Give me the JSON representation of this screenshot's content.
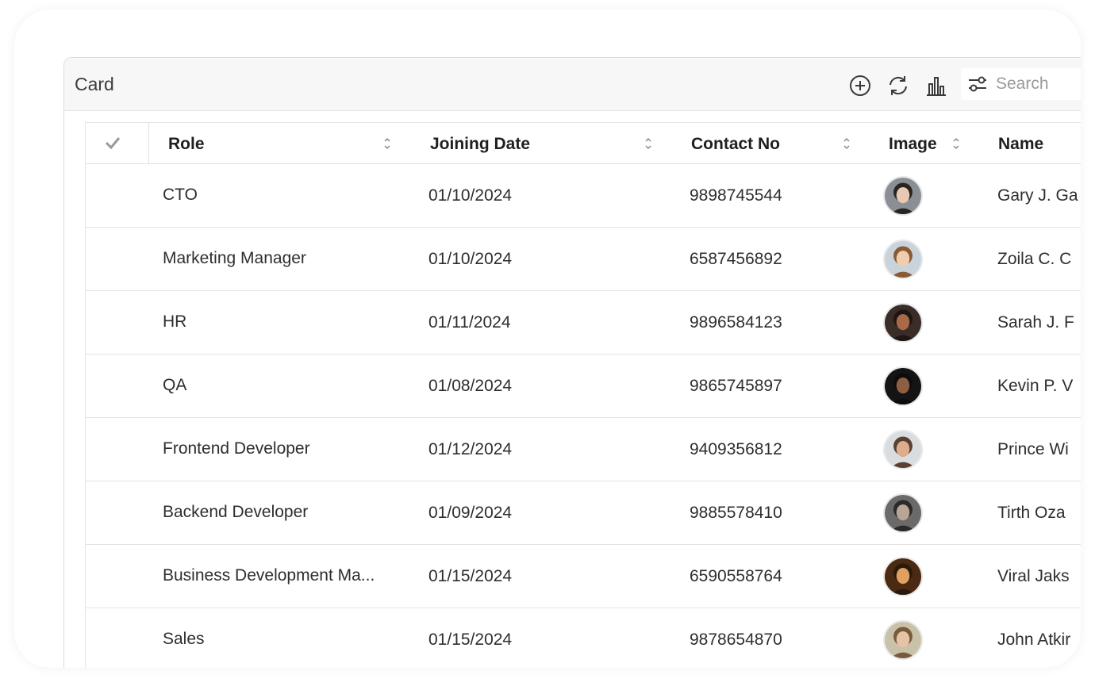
{
  "card": {
    "title": "Card",
    "search_placeholder": "Search",
    "toolbar_icons": [
      "add-circle-icon",
      "refresh-icon",
      "chart-icon",
      "filter-icon"
    ]
  },
  "grid": {
    "columns": [
      "Role",
      "Joining Date",
      "Contact No",
      "Image",
      "Name"
    ],
    "rows": [
      {
        "role": "CTO",
        "joining_date": "01/10/2024",
        "contact": "9898745544",
        "name": "Gary J. Ga",
        "avatar_bg": "#8a8f96",
        "avatar_skin": "#e9c9b3",
        "avatar_hair": "#2a2420"
      },
      {
        "role": "Marketing Manager",
        "joining_date": "01/10/2024",
        "contact": "6587456892",
        "name": "Zoila C. C",
        "avatar_bg": "#c9d3dc",
        "avatar_skin": "#f1cdb0",
        "avatar_hair": "#8a5a34"
      },
      {
        "role": "HR",
        "joining_date": "01/11/2024",
        "contact": "9896584123",
        "name": "Sarah J. F",
        "avatar_bg": "#3a2c26",
        "avatar_skin": "#a86a48",
        "avatar_hair": "#1e1612"
      },
      {
        "role": "QA",
        "joining_date": "01/08/2024",
        "contact": "9865745897",
        "name": "Kevin P. V",
        "avatar_bg": "#141414",
        "avatar_skin": "#8e5e42",
        "avatar_hair": "#0c0c0c"
      },
      {
        "role": "Frontend Developer",
        "joining_date": "01/12/2024",
        "contact": "9409356812",
        "name": "Prince Wi",
        "avatar_bg": "#d9dde0",
        "avatar_skin": "#dcae8c",
        "avatar_hair": "#5a4030"
      },
      {
        "role": "Backend Developer",
        "joining_date": "01/09/2024",
        "contact": "9885578410",
        "name": "Tirth Oza",
        "avatar_bg": "#6a6a6a",
        "avatar_skin": "#b9a596",
        "avatar_hair": "#2a2a2a"
      },
      {
        "role": "Business Development Ma...",
        "joining_date": "01/15/2024",
        "contact": "6590558764",
        "name": "Viral Jaks",
        "avatar_bg": "#4a2a12",
        "avatar_skin": "#e0a060",
        "avatar_hair": "#2a1a0c"
      },
      {
        "role": "Sales",
        "joining_date": "01/15/2024",
        "contact": "9878654870",
        "name": "John Atkir",
        "avatar_bg": "#c9c2a8",
        "avatar_skin": "#e6c3a4",
        "avatar_hair": "#7a5a3c"
      }
    ]
  }
}
